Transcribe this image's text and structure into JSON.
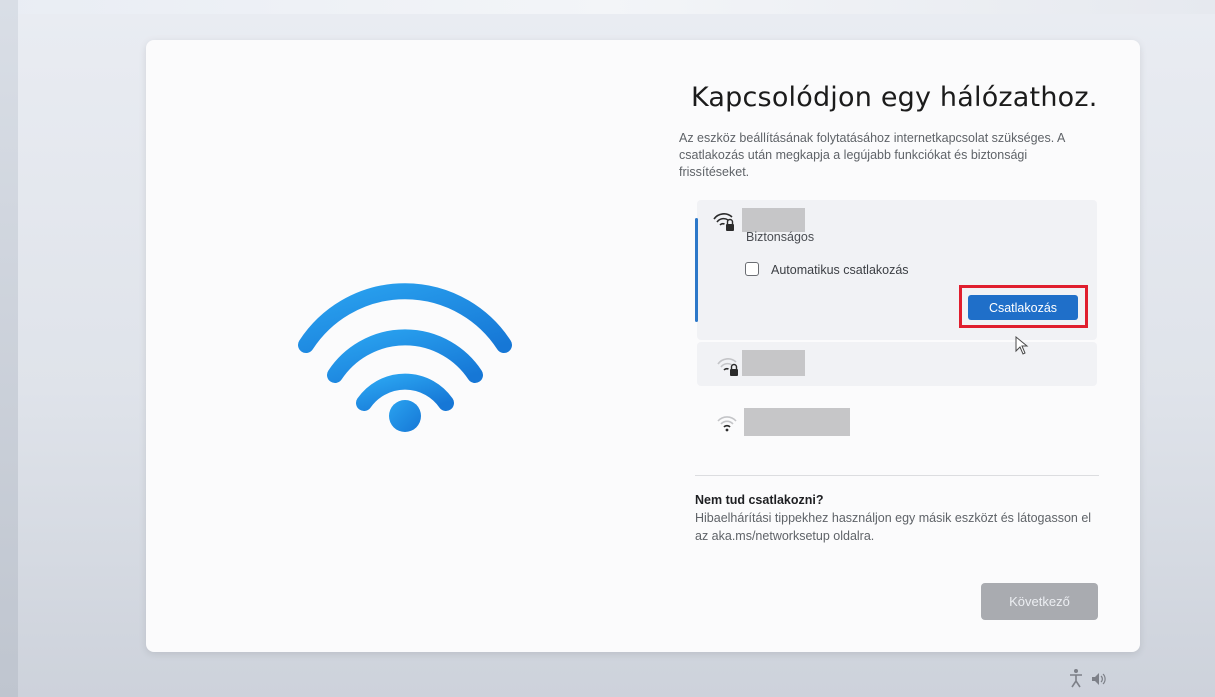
{
  "page": {
    "title": "Kapcsolódjon egy hálózathoz.",
    "description": "Az eszköz beállításának folytatásához internetkapcsolat szükséges. A csatlakozás után megkapja a legújabb funkciókat és biztonsági frissítéseket."
  },
  "networks": {
    "selected": {
      "icon": "wifi-lock-icon",
      "security": "Biztonságos",
      "auto_connect_label": "Automatikus csatlakozás",
      "auto_connect_checked": false,
      "connect_label": "Csatlakozás"
    },
    "others": [
      {
        "icon": "wifi-lock-icon"
      },
      {
        "icon": "wifi-icon"
      }
    ]
  },
  "help": {
    "title": "Nem tud csatlakozni?",
    "text": "Hibaelhárítási tippekhez használjon egy másik eszközt és látogasson el az aka.ms/networksetup oldalra."
  },
  "footer": {
    "next_label": "Következő"
  },
  "colors": {
    "accent": "#1f6fc9",
    "highlight": "#e01e2e",
    "wifi_hero": "#1a8fe8"
  }
}
